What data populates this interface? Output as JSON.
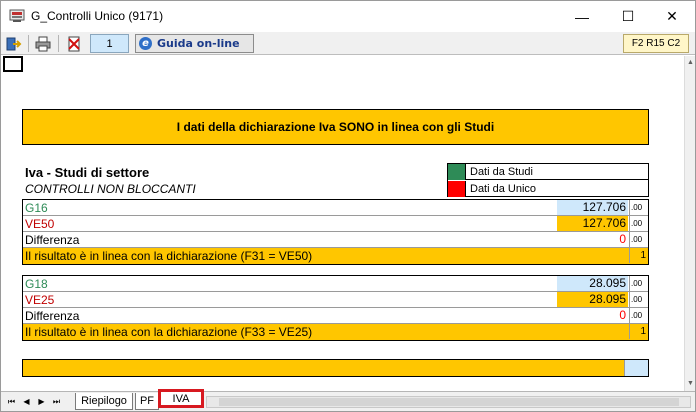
{
  "window": {
    "title": "G_Controlli Unico (9171)",
    "minimize_glyph": "—",
    "maximize_glyph": "☐",
    "close_glyph": "✕"
  },
  "toolbar": {
    "page_number": "1",
    "guide_label": "Guida on-line",
    "guide_icon_glyph": "e",
    "cell_reference": "F2 R15 C2"
  },
  "banner": {
    "text": "I dati della dichiarazione Iva SONO in linea con gli Studi"
  },
  "header": {
    "title": "Iva - Studi di settore",
    "subtitle": "CONTROLLI NON BLOCCANTI"
  },
  "legend": {
    "items": [
      {
        "label": "Dati da Studi",
        "color": "#2e8b57"
      },
      {
        "label": "Dati da Unico",
        "color": "#ff0000"
      }
    ]
  },
  "blocks": [
    {
      "rows": [
        {
          "label": "G16",
          "value": "127.706",
          "decimals": ".00",
          "label_color": "#2e8b57",
          "value_bg": "#cfe8fb"
        },
        {
          "label": "VE50",
          "value": "127.706",
          "decimals": ".00",
          "label_color": "#c00000",
          "value_bg": "#ffc600"
        },
        {
          "label": "Differenza",
          "value": "0",
          "decimals": ".00",
          "label_color": "#000000",
          "value_bg": "#ffffff"
        }
      ],
      "result": {
        "text": "Il risultato è in linea con la dichiarazione (F31 = VE50)",
        "flag": "1"
      }
    },
    {
      "rows": [
        {
          "label": "G18",
          "value": "28.095",
          "decimals": ".00",
          "label_color": "#2e8b57",
          "value_bg": "#cfe8fb"
        },
        {
          "label": "VE25",
          "value": "28.095",
          "decimals": ".00",
          "label_color": "#c00000",
          "value_bg": "#ffc600"
        },
        {
          "label": "Differenza",
          "value": "0",
          "decimals": ".00",
          "label_color": "#000000",
          "value_bg": "#ffffff"
        }
      ],
      "result": {
        "text": "Il risultato è in linea con la dichiarazione (F33 = VE25)",
        "flag": "1"
      }
    }
  ],
  "tabs": {
    "nav": [
      "⏮",
      "◀",
      "▶",
      "⏭"
    ],
    "items": [
      "Riepilogo",
      "PF",
      "IVA"
    ],
    "active": "IVA"
  }
}
